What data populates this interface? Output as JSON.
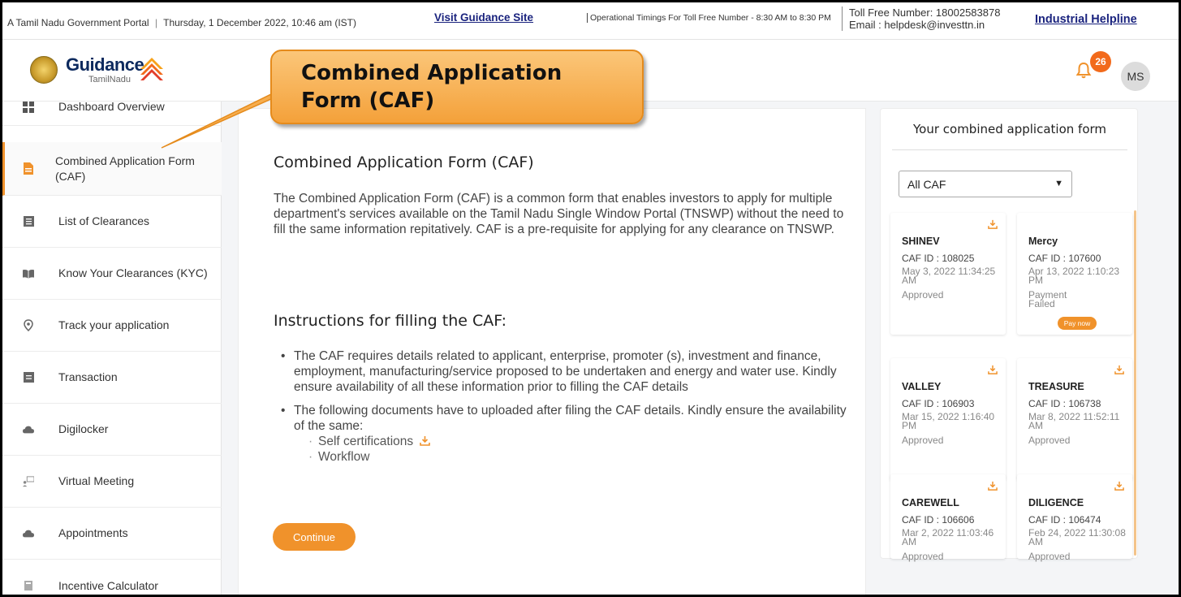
{
  "topbar": {
    "portal": "A Tamil Nadu Government Portal",
    "datetime": "Thursday, 1 December 2022, 10:46 am (IST)",
    "guidance_link": "Visit Guidance Site",
    "operational_timings": "Operational Timings For Toll Free Number - 8:30 AM to 8:30 PM",
    "toll_free": "Toll Free Number: 18002583878",
    "email": "Email : helpdesk@investtn.in",
    "industrial_helpline": "Industrial Helpline"
  },
  "header": {
    "logo_word": "Guidance",
    "logo_sub": "TamilNadu",
    "notification_count": "26",
    "avatar_initials": "MS"
  },
  "callout": {
    "line1": "Combined Application",
    "line2": "Form (CAF)"
  },
  "sidebar": {
    "items": [
      {
        "label": "Dashboard Overview",
        "icon": "grid-icon"
      },
      {
        "label": "Combined Application Form (CAF)",
        "icon": "document-icon",
        "active": true
      },
      {
        "label": "List of Clearances",
        "icon": "list-icon"
      },
      {
        "label": "Know Your Clearances (KYC)",
        "icon": "book-icon"
      },
      {
        "label": "Track your application",
        "icon": "location-pin-icon"
      },
      {
        "label": "Transaction",
        "icon": "receipt-icon"
      },
      {
        "label": "Digilocker",
        "icon": "cloud-icon"
      },
      {
        "label": "Virtual Meeting",
        "icon": "video-meeting-icon"
      },
      {
        "label": "Appointments",
        "icon": "cloud-icon"
      },
      {
        "label": "Incentive Calculator",
        "icon": "calculator-icon"
      }
    ]
  },
  "main": {
    "title": "Combined Application Form (CAF)",
    "intro": "The Combined Application Form (CAF) is a common form that enables investors to apply for multiple department's services available on the Tamil Nadu Single Window Portal (TNSWP) without the need to fill the same information repitatively. CAF is a pre-requisite for applying for any clearance on TNSWP.",
    "instructions_title": "Instructions for filling the CAF:",
    "bullet1": "The CAF requires details related to applicant, enterprise, promoter (s), investment and finance, employment, manufacturing/service proposed to be undertaken and energy and water use. Kindly ensure availability of all these information prior to filling the CAF details",
    "bullet2": "The following documents have to uploaded after filing the CAF details. Kindly ensure the availability of the same:",
    "subitems": [
      "Self certifications",
      "Workflow"
    ],
    "continue_label": "Continue"
  },
  "right_panel": {
    "title": "Your combined application form",
    "select_value": "All CAF",
    "pay_now_label": "Pay now",
    "cafs": [
      {
        "name": "SHINEV",
        "id": "CAF ID : 108025",
        "date": "May 3, 2022 11:34:25 AM",
        "status": "Approved"
      },
      {
        "name": "Mercy",
        "id": "CAF ID : 107600",
        "date": "Apr 13, 2022 1:10:23 PM",
        "status": "Payment Failed"
      },
      {
        "name": "VALLEY",
        "id": "CAF ID : 106903",
        "date": "Mar 15, 2022 1:16:40 PM",
        "status": "Approved"
      },
      {
        "name": "TREASURE",
        "id": "CAF ID : 106738",
        "date": "Mar 8, 2022 11:52:11 AM",
        "status": "Approved"
      },
      {
        "name": "CAREWELL",
        "id": "CAF ID : 106606",
        "date": "Mar 2, 2022 11:03:46 AM",
        "status": "Approved"
      },
      {
        "name": "DILIGENCE",
        "id": "CAF ID : 106474",
        "date": "Feb 24, 2022 11:30:08 AM",
        "status": "Approved"
      }
    ]
  },
  "colors": {
    "accent_orange": "#f0922b",
    "link_navy": "#1a237e",
    "badge_orange": "#f26a1b"
  }
}
